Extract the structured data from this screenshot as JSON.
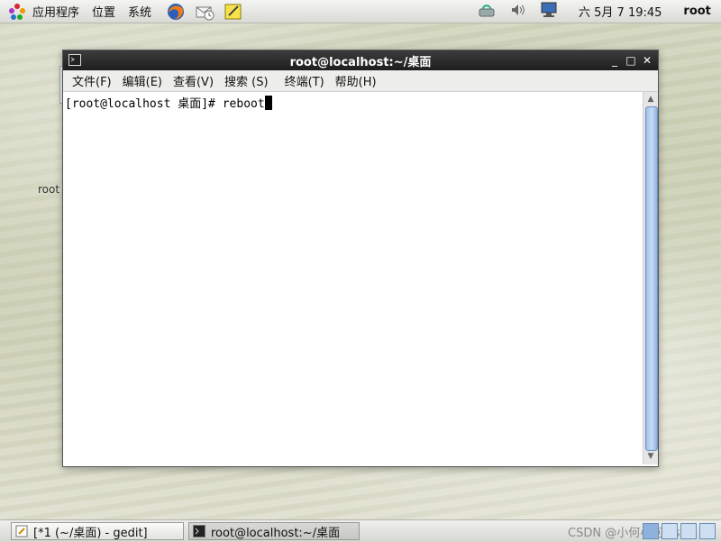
{
  "top_panel": {
    "menus": [
      "应用程序",
      "位置",
      "系统"
    ],
    "date_time": "六 5月  7 19:45",
    "user": "root"
  },
  "desktop": {
    "icon_label": "root"
  },
  "terminal": {
    "title": "root@localhost:~/桌面",
    "menus": [
      "文件(F)",
      "编辑(E)",
      "查看(V)",
      "搜索 (S)",
      "终端(T)",
      "帮助(H)"
    ],
    "prompt": "[root@localhost 桌面]# ",
    "command": "reboot"
  },
  "taskbar": {
    "tasks": [
      {
        "label": "[*1 (~/桌面) - gedit]"
      },
      {
        "label": "root@localhost:~/桌面"
      }
    ],
    "watermark": "CSDN @小何小何ios"
  },
  "colors": {
    "titlebar": "#1e1e1e",
    "scroll_thumb": "#9fc0ea"
  }
}
